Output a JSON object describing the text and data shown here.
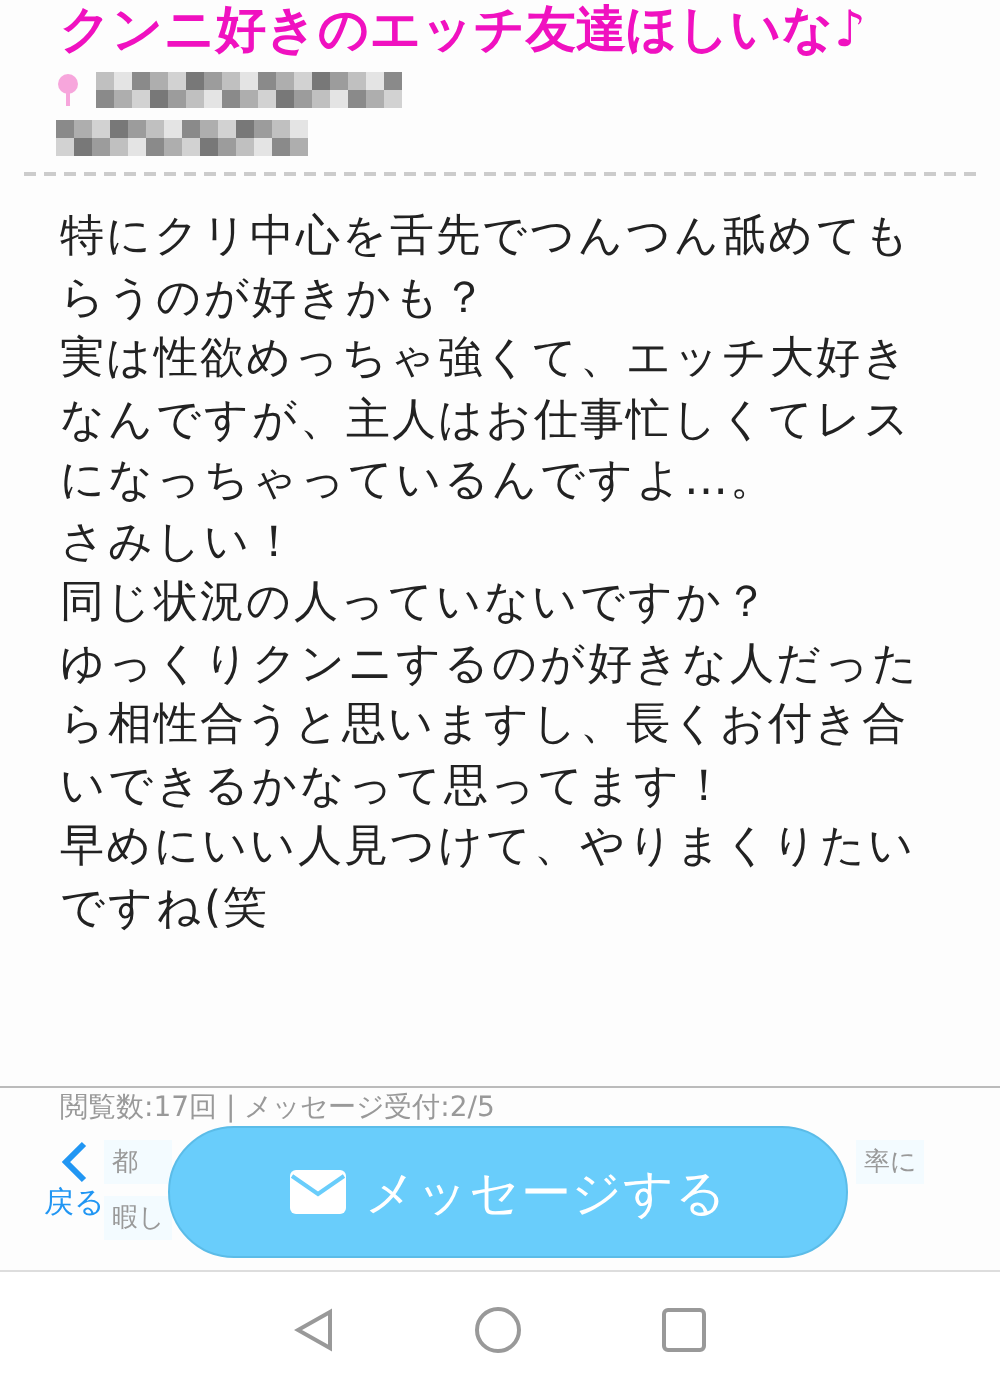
{
  "post": {
    "title": "クンニ好きのエッチ友達ほしいな♪",
    "body": [
      "特にクリ中心を舌先でつんつん舐めてもらうのが好きかも？",
      "実は性欲めっちゃ強くて、エッチ大好きなんですが、主人はお仕事忙しくてレスになっちゃっているんですよ…。",
      "さみしい！",
      "同じ状況の人っていないですか？",
      "ゆっくりクンニするのが好きな人だったら相性合うと思いますし、長くお付き合いできるかなって思ってます！",
      "早めにいい人見つけて、やりまくりたいですね(笑"
    ],
    "stats": "閲覧数:17回 | メッセージ受付:2/5"
  },
  "chips": [
    "都",
    "暇し",
    "率に"
  ],
  "back": {
    "label": "戻る"
  },
  "message_button": {
    "label": "メッセージする"
  }
}
